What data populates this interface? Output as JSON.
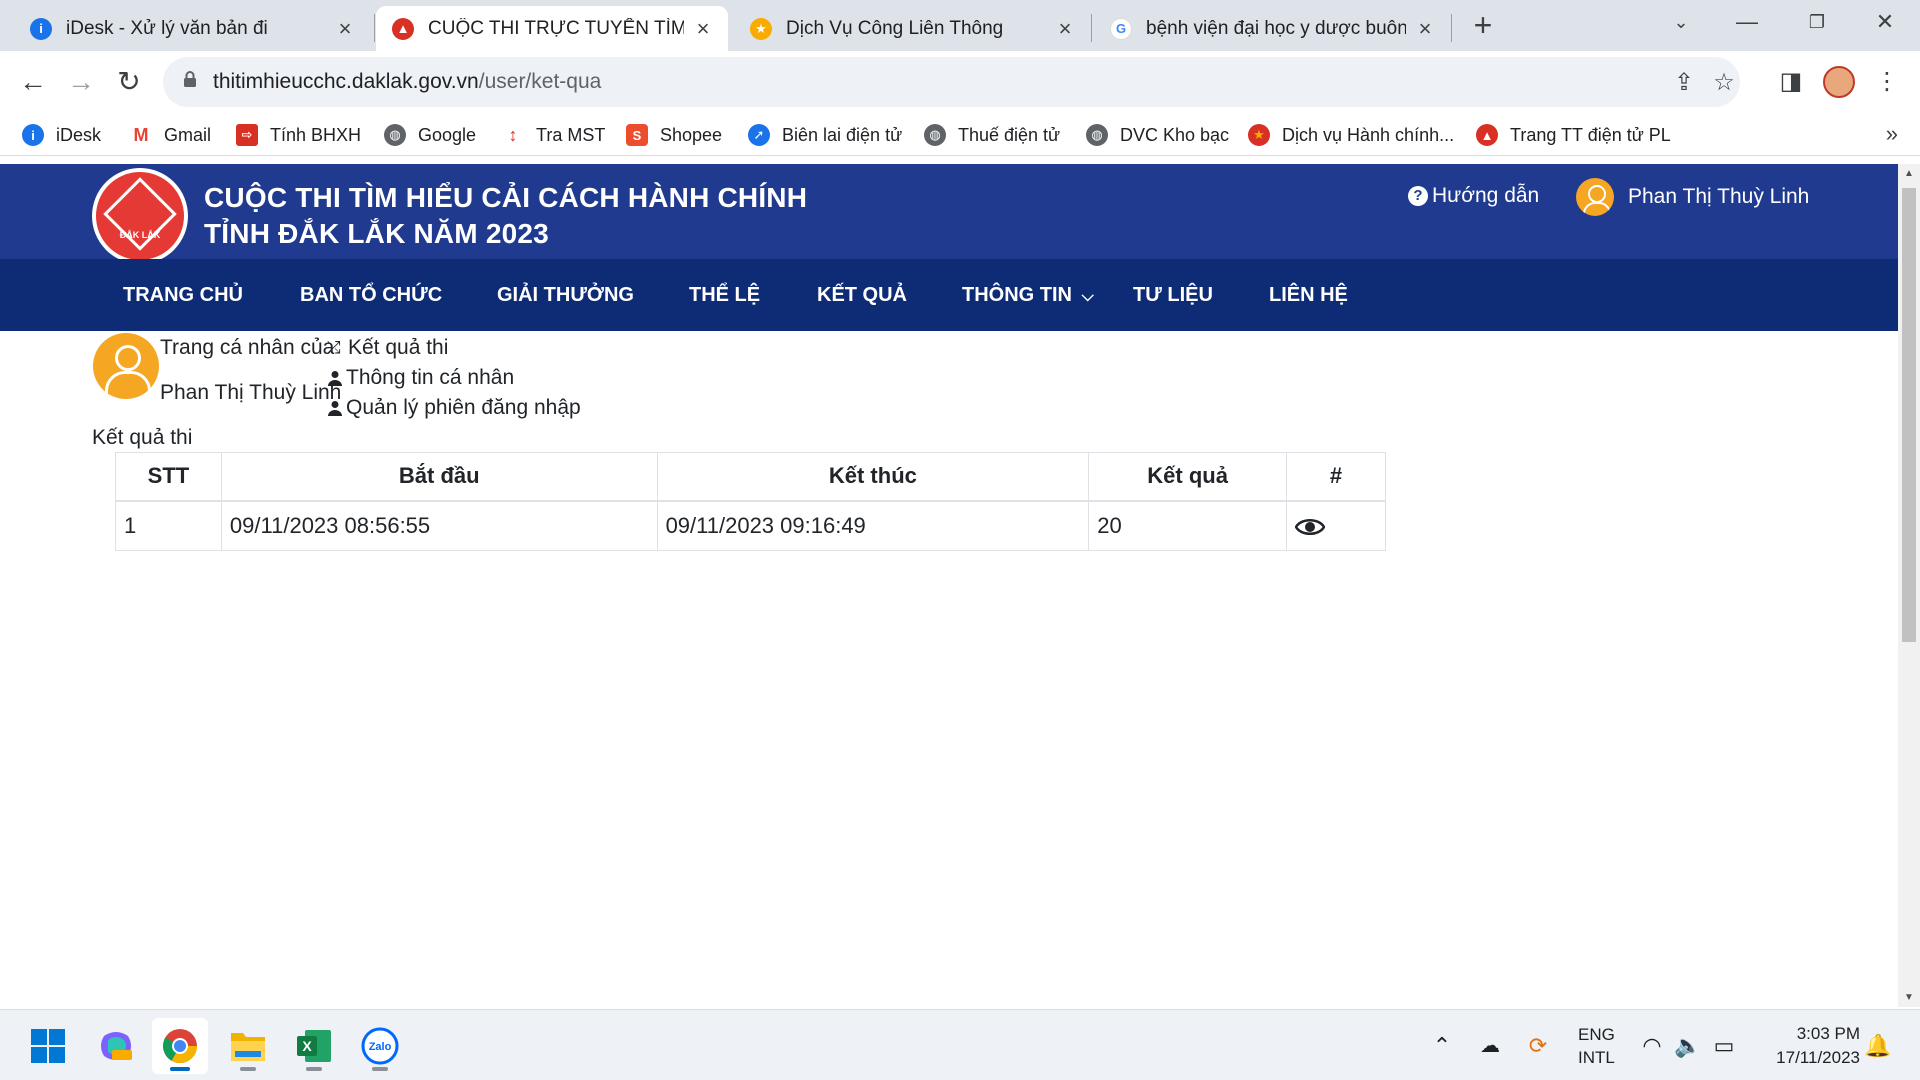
{
  "browser": {
    "tabs": [
      {
        "title": "iDesk - Xử lý văn bản đi",
        "icon": "idesk-icon",
        "color": "#1a73e8"
      },
      {
        "title": "CUỘC THI TRỰC TUYẾN TÌM HIỂ",
        "icon": "daklak-icon",
        "color": "#d93025"
      },
      {
        "title": "Dịch Vụ Công Liên Thông",
        "icon": "dvc-icon",
        "color": "#f9ab00"
      },
      {
        "title": "bệnh viện đại học y dược buôn m",
        "icon": "google-icon",
        "color": "#4285f4"
      }
    ],
    "new_tab": "+",
    "url_host": "thitimhieucchc.daklak.gov.vn",
    "url_path": "/user/ket-qua",
    "bookmarks": [
      {
        "label": "iDesk",
        "icon": "idesk-icon",
        "color": "#1a73e8"
      },
      {
        "label": "Gmail",
        "icon": "gmail-icon",
        "color": "#ea4335"
      },
      {
        "label": "Tính BHXH",
        "icon": "bhxh-icon",
        "color": "#d93025"
      },
      {
        "label": "Google",
        "icon": "globe-icon",
        "color": "#5f6368"
      },
      {
        "label": "Tra MST",
        "icon": "tramst-icon",
        "color": "#d93025"
      },
      {
        "label": "Shopee",
        "icon": "shopee-icon",
        "color": "#ee4d2d"
      },
      {
        "label": "Biên lai điện tử",
        "icon": "bienlai-icon",
        "color": "#1a73e8"
      },
      {
        "label": "Thuế điện tử",
        "icon": "globe-icon",
        "color": "#5f6368"
      },
      {
        "label": "DVC Kho bạc",
        "icon": "globe-icon",
        "color": "#5f6368"
      },
      {
        "label": "Dịch vụ Hành chính...",
        "icon": "emblem-icon",
        "color": "#d93025"
      },
      {
        "label": "Trang TT điện tử PL",
        "icon": "daklak-icon",
        "color": "#d93025"
      }
    ]
  },
  "site": {
    "title_line1": "CUỘC THI TÌM HIỂU CẢI CÁCH HÀNH CHÍNH",
    "title_line2": "TỈNH ĐẮK LẮK NĂM 2023",
    "logo_text": "ĐẮK LẮK",
    "help": "Hướng dẫn",
    "user_name": "Phan Thị Thuỳ Linh",
    "nav": [
      {
        "label": "TRANG CHỦ"
      },
      {
        "label": "BAN TỔ CHỨC"
      },
      {
        "label": "GIẢI THƯỞNG"
      },
      {
        "label": "THỂ LỆ"
      },
      {
        "label": "KẾT QUẢ"
      },
      {
        "label": "THÔNG TIN"
      },
      {
        "label": "TƯ LIỆU"
      },
      {
        "label": "LIÊN HỆ"
      }
    ],
    "colors": {
      "header": "#1f3a8f",
      "nav": "#0e2c75",
      "avatar": "#f5a623"
    }
  },
  "profile": {
    "heading": "Trang cá nhân của",
    "name": "Phan Thị Thuỳ Linh",
    "menu": [
      {
        "label": "Kết quả thi",
        "icon": "shuffle-icon"
      },
      {
        "label": "Thông tin cá nhân",
        "icon": "user-icon"
      },
      {
        "label": "Quản lý phiên đăng nhập",
        "icon": "user-icon"
      }
    ]
  },
  "results": {
    "title": "Kết quả thi",
    "columns": [
      "STT",
      "Bắt đầu",
      "Kết thúc",
      "Kết quả",
      "#"
    ],
    "rows": [
      {
        "stt": "1",
        "start": "09/11/2023 08:56:55",
        "end": "09/11/2023 09:16:49",
        "score": "20"
      }
    ]
  },
  "taskbar": {
    "lang_line1": "ENG",
    "lang_line2": "INTL",
    "time": "3:03 PM",
    "date": "17/11/2023"
  }
}
